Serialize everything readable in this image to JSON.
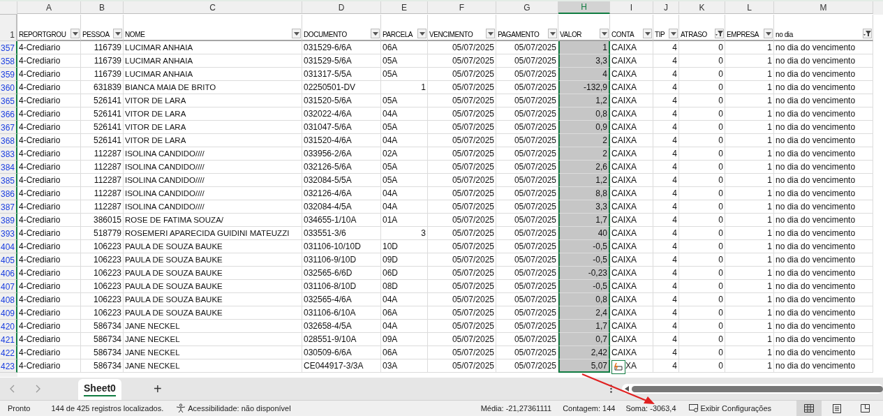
{
  "columns": [
    {
      "letter": "A",
      "header": "REPORTGROU",
      "filtered": false,
      "selected": false
    },
    {
      "letter": "B",
      "header": "PESSOA",
      "filtered": false,
      "selected": false
    },
    {
      "letter": "C",
      "header": "NOME",
      "filtered": false,
      "selected": false
    },
    {
      "letter": "D",
      "header": "DOCUMENTO",
      "filtered": false,
      "selected": false
    },
    {
      "letter": "E",
      "header": "PARCELA",
      "filtered": false,
      "selected": false
    },
    {
      "letter": "F",
      "header": "VENCIMENTO",
      "filtered": false,
      "selected": false
    },
    {
      "letter": "G",
      "header": "PAGAMENTO",
      "filtered": false,
      "selected": false
    },
    {
      "letter": "H",
      "header": "VALOR",
      "filtered": false,
      "selected": true
    },
    {
      "letter": "I",
      "header": "CONTA",
      "filtered": false,
      "selected": false
    },
    {
      "letter": "J",
      "header": "TIP",
      "filtered": false,
      "selected": false
    },
    {
      "letter": "K",
      "header": "ATRASO",
      "filtered": true,
      "selected": false
    },
    {
      "letter": "L",
      "header": "EMPRESA",
      "filtered": false,
      "selected": false
    },
    {
      "letter": "M",
      "header": "no dia",
      "filtered": true,
      "selected": false
    }
  ],
  "header_row_number": "1",
  "rows": [
    {
      "n": "357",
      "cells": [
        "4-Crediario",
        "116739",
        "LUCIMAR ANHAIA",
        "031529-6/6A",
        "06A",
        "05/07/2025",
        "05/07/2025",
        "1",
        "CAIXA",
        "4",
        "0",
        "1",
        "no dia do vencimento"
      ]
    },
    {
      "n": "358",
      "cells": [
        "4-Crediario",
        "116739",
        "LUCIMAR ANHAIA",
        "031529-5/6A",
        "05A",
        "05/07/2025",
        "05/07/2025",
        "3,3",
        "CAIXA",
        "4",
        "0",
        "1",
        "no dia do vencimento"
      ]
    },
    {
      "n": "359",
      "cells": [
        "4-Crediario",
        "116739",
        "LUCIMAR ANHAIA",
        "031317-5/5A",
        "05A",
        "05/07/2025",
        "05/07/2025",
        "4",
        "CAIXA",
        "4",
        "0",
        "1",
        "no dia do vencimento"
      ]
    },
    {
      "n": "360",
      "cells": [
        "4-Crediario",
        "631839",
        "BIANCA MAIA DE BRITO",
        "02250501-DV",
        "1",
        "05/07/2025",
        "05/07/2025",
        "-132,9",
        "CAIXA",
        "4",
        "0",
        "1",
        "no dia do vencimento"
      ],
      "kind": "numeric_parcela"
    },
    {
      "n": "365",
      "cells": [
        "4-Crediario",
        "526141",
        "VITOR DE LARA",
        "031520-5/6A",
        "05A",
        "05/07/2025",
        "05/07/2025",
        "1,2",
        "CAIXA",
        "4",
        "0",
        "1",
        "no dia do vencimento"
      ]
    },
    {
      "n": "366",
      "cells": [
        "4-Crediario",
        "526141",
        "VITOR DE LARA",
        "032022-4/6A",
        "04A",
        "05/07/2025",
        "05/07/2025",
        "0,8",
        "CAIXA",
        "4",
        "0",
        "1",
        "no dia do vencimento"
      ]
    },
    {
      "n": "367",
      "cells": [
        "4-Crediario",
        "526141",
        "VITOR DE LARA",
        "031047-5/6A",
        "05A",
        "05/07/2025",
        "05/07/2025",
        "0,9",
        "CAIXA",
        "4",
        "0",
        "1",
        "no dia do vencimento"
      ]
    },
    {
      "n": "368",
      "cells": [
        "4-Crediario",
        "526141",
        "VITOR DE LARA",
        "031520-4/6A",
        "04A",
        "05/07/2025",
        "05/07/2025",
        "2",
        "CAIXA",
        "4",
        "0",
        "1",
        "no dia do vencimento"
      ]
    },
    {
      "n": "383",
      "cells": [
        "4-Crediario",
        "112287",
        "ISOLINA CANDIDO////",
        "033956-2/6A",
        "02A",
        "05/07/2025",
        "05/07/2025",
        "2",
        "CAIXA",
        "4",
        "0",
        "1",
        "no dia do vencimento"
      ]
    },
    {
      "n": "384",
      "cells": [
        "4-Crediario",
        "112287",
        "ISOLINA CANDIDO////",
        "032126-5/6A",
        "05A",
        "05/07/2025",
        "05/07/2025",
        "2,6",
        "CAIXA",
        "4",
        "0",
        "1",
        "no dia do vencimento"
      ]
    },
    {
      "n": "385",
      "cells": [
        "4-Crediario",
        "112287",
        "ISOLINA CANDIDO////",
        "032084-5/5A",
        "05A",
        "05/07/2025",
        "05/07/2025",
        "1,2",
        "CAIXA",
        "4",
        "0",
        "1",
        "no dia do vencimento"
      ]
    },
    {
      "n": "386",
      "cells": [
        "4-Crediario",
        "112287",
        "ISOLINA CANDIDO////",
        "032126-4/6A",
        "04A",
        "05/07/2025",
        "05/07/2025",
        "8,8",
        "CAIXA",
        "4",
        "0",
        "1",
        "no dia do vencimento"
      ]
    },
    {
      "n": "387",
      "cells": [
        "4-Crediario",
        "112287",
        "ISOLINA CANDIDO////",
        "032084-4/5A",
        "04A",
        "05/07/2025",
        "05/07/2025",
        "3,3",
        "CAIXA",
        "4",
        "0",
        "1",
        "no dia do vencimento"
      ]
    },
    {
      "n": "389",
      "cells": [
        "4-Crediario",
        "386015",
        "ROSE DE FATIMA SOUZA/",
        "034655-1/10A",
        "01A",
        "05/07/2025",
        "05/07/2025",
        "1,7",
        "CAIXA",
        "4",
        "0",
        "1",
        "no dia do vencimento"
      ]
    },
    {
      "n": "393",
      "cells": [
        "4-Crediario",
        "518779",
        "ROSEMERI APARECIDA GUIDINI MATEUZZI",
        "033551-3/6",
        "3",
        "05/07/2025",
        "05/07/2025",
        "40",
        "CAIXA",
        "4",
        "0",
        "1",
        "no dia do vencimento"
      ],
      "kind": "numeric_parcela"
    },
    {
      "n": "404",
      "cells": [
        "4-Crediario",
        "106223",
        "PAULA DE SOUZA BAUKE",
        "031106-10/10D",
        "10D",
        "05/07/2025",
        "05/07/2025",
        "-0,5",
        "CAIXA",
        "4",
        "0",
        "1",
        "no dia do vencimento"
      ]
    },
    {
      "n": "405",
      "cells": [
        "4-Crediario",
        "106223",
        "PAULA DE SOUZA BAUKE",
        "031106-9/10D",
        "09D",
        "05/07/2025",
        "05/07/2025",
        "-0,5",
        "CAIXA",
        "4",
        "0",
        "1",
        "no dia do vencimento"
      ]
    },
    {
      "n": "406",
      "cells": [
        "4-Crediario",
        "106223",
        "PAULA DE SOUZA BAUKE",
        "032565-6/6D",
        "06D",
        "05/07/2025",
        "05/07/2025",
        "-0,23",
        "CAIXA",
        "4",
        "0",
        "1",
        "no dia do vencimento"
      ]
    },
    {
      "n": "407",
      "cells": [
        "4-Crediario",
        "106223",
        "PAULA DE SOUZA BAUKE",
        "031106-8/10D",
        "08D",
        "05/07/2025",
        "05/07/2025",
        "-0,5",
        "CAIXA",
        "4",
        "0",
        "1",
        "no dia do vencimento"
      ]
    },
    {
      "n": "408",
      "cells": [
        "4-Crediario",
        "106223",
        "PAULA DE SOUZA BAUKE",
        "032565-4/6A",
        "04A",
        "05/07/2025",
        "05/07/2025",
        "0,8",
        "CAIXA",
        "4",
        "0",
        "1",
        "no dia do vencimento"
      ]
    },
    {
      "n": "409",
      "cells": [
        "4-Crediario",
        "106223",
        "PAULA DE SOUZA BAUKE",
        "031106-6/10A",
        "06A",
        "05/07/2025",
        "05/07/2025",
        "2,4",
        "CAIXA",
        "4",
        "0",
        "1",
        "no dia do vencimento"
      ]
    },
    {
      "n": "420",
      "cells": [
        "4-Crediario",
        "586734",
        "JANE NECKEL",
        "032658-4/5A",
        "04A",
        "05/07/2025",
        "05/07/2025",
        "1,7",
        "CAIXA",
        "4",
        "0",
        "1",
        "no dia do vencimento"
      ]
    },
    {
      "n": "421",
      "cells": [
        "4-Crediario",
        "586734",
        "JANE NECKEL",
        "028551-9/10A",
        "09A",
        "05/07/2025",
        "05/07/2025",
        "0,7",
        "CAIXA",
        "4",
        "0",
        "1",
        "no dia do vencimento"
      ]
    },
    {
      "n": "422",
      "cells": [
        "4-Crediario",
        "586734",
        "JANE NECKEL",
        "030509-6/6A",
        "06A",
        "05/07/2025",
        "05/07/2025",
        "2,42",
        "CAIXA",
        "4",
        "0",
        "1",
        "no dia do vencimento"
      ]
    },
    {
      "n": "423",
      "cells": [
        "4-Crediario",
        "586734",
        "JANE NECKEL",
        "CE044917-3/3A",
        "03A",
        "05/07/2025",
        "05/07/2025",
        "5,07",
        "XA",
        "4",
        "0",
        "1",
        "no dia do vencimento"
      ]
    }
  ],
  "sheet_tabs": [
    {
      "label": "Sheet0",
      "selected": true
    }
  ],
  "add_sheet": "+",
  "status_bar": {
    "mode": "Pronto",
    "records": "144 de 425 registros localizados.",
    "accessibility": "Acessibilidade: não disponível",
    "average": "Média: -21,27361111",
    "count": "Contagem: 144",
    "sum": "Soma: -3063,4",
    "settings": "Exibir Configurações",
    "views": [
      {
        "kind": "normal",
        "selected": true
      },
      {
        "kind": "page_layout",
        "selected": false
      },
      {
        "kind": "page_break",
        "selected": false
      }
    ]
  }
}
